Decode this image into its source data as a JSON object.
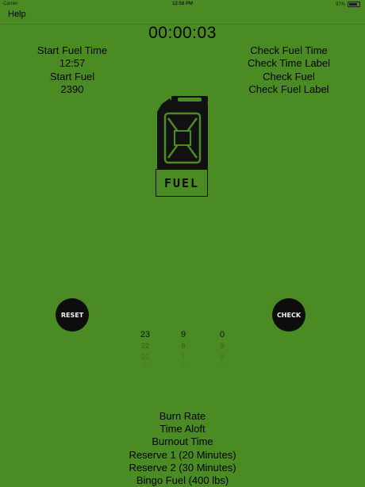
{
  "status": {
    "carrier": "Carrier",
    "time": "12:58 PM",
    "battery": "97%"
  },
  "nav": {
    "help": "Help"
  },
  "timer": "00:00:03",
  "left": {
    "start_fuel_time_label": "Start Fuel Time",
    "start_fuel_time_value": "12:57",
    "start_fuel_label": "Start Fuel",
    "start_fuel_value": "2390"
  },
  "right": {
    "check_fuel_time_label": "Check Fuel Time",
    "check_time_label": "Check Time Label",
    "check_fuel_label": "Check Fuel",
    "check_fuel_label_value": "Check Fuel Label"
  },
  "logo": {
    "text": "FUEL"
  },
  "buttons": {
    "reset": "RESET",
    "check": "CHECK"
  },
  "picker": {
    "col1": [
      "23",
      "22",
      "21",
      "20"
    ],
    "col2": [
      "9",
      "8",
      "7",
      "6"
    ],
    "col3": [
      "0",
      "9",
      "8",
      "7"
    ]
  },
  "results": {
    "burn_rate": "Burn Rate",
    "time_aloft": "Time Aloft",
    "burnout_time": "Burnout Time",
    "reserve1": "Reserve 1 (20 Minutes)",
    "reserve2": "Reserve 2 (30 Minutes)",
    "bingo": "Bingo Fuel (400 lbs)"
  },
  "colors": {
    "background": "#4b8b24",
    "button": "#0d0d0d"
  }
}
